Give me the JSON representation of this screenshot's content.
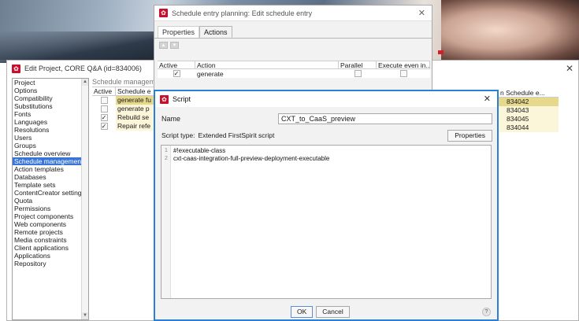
{
  "project_window": {
    "title": "Edit Project, CORE Q&A (id=834006)",
    "nav_items": [
      "Project",
      "Options",
      "Compatibility",
      "Substitutions",
      "Fonts",
      "Languages",
      "Resolutions",
      "Users",
      "Groups",
      "Schedule overview",
      "Schedule management",
      "Action templates",
      "Databases",
      "Template sets",
      "ContentCreator settings",
      "Quota",
      "Permissions",
      "Project components",
      "Web components",
      "Remote projects",
      "Media constraints",
      "Client applications",
      "Applications",
      "Repository"
    ],
    "selected_nav": "Schedule management",
    "schedule_panel_label": "Schedule managem",
    "table_headers": {
      "active": "Active",
      "schedule_entry": "Schedule e"
    },
    "rows": [
      {
        "name": "generate fu",
        "checked": false,
        "selected": true
      },
      {
        "name": "generate p",
        "checked": false,
        "selected": false
      },
      {
        "name": "Rebuild se",
        "checked": true,
        "selected": false
      },
      {
        "name": "Repair refe",
        "checked": true,
        "selected": false
      }
    ],
    "right_column_header": "n  Schedule e...",
    "right_column_values": [
      "834042",
      "834043",
      "834045",
      "834044"
    ]
  },
  "plan_window": {
    "title": "Schedule entry planning: Edit schedule entry",
    "tabs": [
      "Properties",
      "Actions"
    ],
    "active_tab": "Actions",
    "headers": {
      "active": "Active",
      "action": "Action",
      "parallel": "Parallel",
      "execute_even": "Execute even in..."
    },
    "rows": [
      {
        "active": true,
        "action": "generate",
        "parallel": false,
        "execute_even": false
      }
    ]
  },
  "script_dialog": {
    "title": "Script",
    "name_label": "Name",
    "name_value": "CXT_to_CaaS_preview",
    "script_type_label": "Script type:",
    "script_type_value": "Extended FirstSpirit script",
    "properties_button": "Properties",
    "code_lines": [
      "#!executable-class",
      "cxt-caas-integration-full-preview-deployment-executable"
    ],
    "line_numbers": [
      "1",
      "2"
    ],
    "ok_button": "OK",
    "cancel_button": "Cancel",
    "help": "?"
  }
}
